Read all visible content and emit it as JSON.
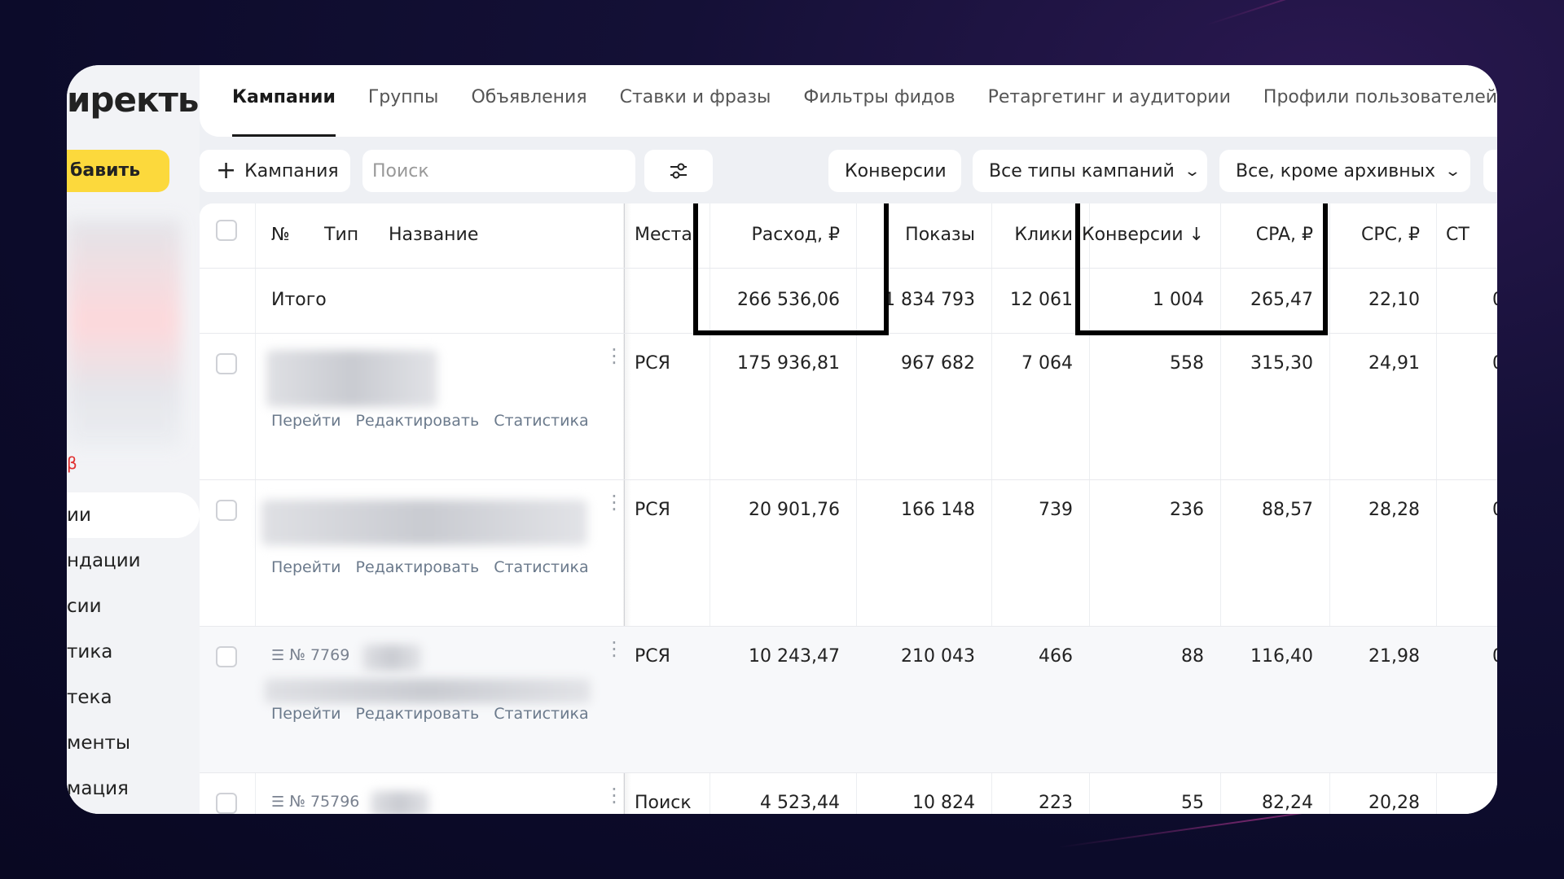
{
  "sidebar": {
    "logo": "иректь",
    "add_button": "бавить",
    "beta": "β",
    "items": [
      {
        "label": "ии",
        "active": true
      },
      {
        "label": "ндации",
        "active": false
      },
      {
        "label": "сии",
        "active": false
      },
      {
        "label": "тика",
        "active": false
      },
      {
        "label": "тека",
        "active": false
      },
      {
        "label": "менты",
        "active": false
      },
      {
        "label": "мация",
        "active": false
      }
    ]
  },
  "tabs": [
    {
      "label": "Кампании",
      "active": true
    },
    {
      "label": "Группы"
    },
    {
      "label": "Объявления"
    },
    {
      "label": "Ставки и фразы"
    },
    {
      "label": "Фильтры фидов"
    },
    {
      "label": "Ретаргетинг и аудитории"
    },
    {
      "label": "Профили пользователей"
    }
  ],
  "toolbar": {
    "add_campaign": "Кампания",
    "search_placeholder": "Поиск",
    "conversions": "Конверсии",
    "campaign_types": "Все типы кампаний",
    "archive_filter": "Все, кроме архивных"
  },
  "table": {
    "headers": {
      "num": "№",
      "type": "Тип",
      "name": "Название",
      "places": "Места",
      "spend": "Расход, ₽",
      "impressions": "Показы",
      "clicks": "Клики",
      "conversions": "Конверсии ↓",
      "cpa": "CPA, ₽",
      "cpc": "CPC, ₽",
      "ctr": "СТ"
    },
    "total": {
      "label": "Итого",
      "spend": "266 536,06",
      "impressions": "1 834 793",
      "clicks": "12 061",
      "conversions": "1 004",
      "cpa": "265,47",
      "cpc": "22,10",
      "ctr": "0"
    },
    "row_links": [
      "Перейти",
      "Редактировать",
      "Статистика"
    ],
    "rows": [
      {
        "id": "",
        "places": "РСЯ",
        "spend": "175 936,81",
        "impressions": "967 682",
        "clicks": "7 064",
        "conversions": "558",
        "cpa": "315,30",
        "cpc": "24,91",
        "ctr": "0"
      },
      {
        "id": "",
        "places": "РСЯ",
        "spend": "20 901,76",
        "impressions": "166 148",
        "clicks": "739",
        "conversions": "236",
        "cpa": "88,57",
        "cpc": "28,28",
        "ctr": "0"
      },
      {
        "id": "№ 7769",
        "places": "РСЯ",
        "spend": "10 243,47",
        "impressions": "210 043",
        "clicks": "466",
        "conversions": "88",
        "cpa": "116,40",
        "cpc": "21,98",
        "ctr": "0"
      },
      {
        "id": "№ 75796",
        "places": "Поиск",
        "spend": "4 523,44",
        "impressions": "10 824",
        "clicks": "223",
        "conversions": "55",
        "cpa": "82,24",
        "cpc": "20,28",
        "ctr": ""
      }
    ]
  }
}
